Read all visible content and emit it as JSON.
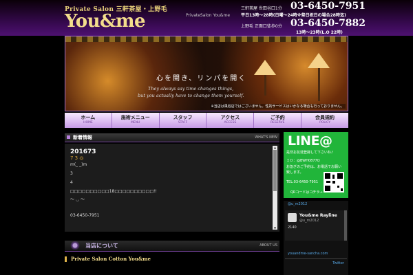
{
  "header": {
    "brand_top": "Private Salon 三軒茶屋・上野毛",
    "logo": "You&me",
    "brand_sub": "PrivateSalon You&me",
    "shop1": {
      "loc": "三軒茶屋 世田谷口1分",
      "phone": "03-6450-7951",
      "hours": "平日13時～28時(日曜～24時※祭日祝日の場合28時迄)"
    },
    "shop2": {
      "loc": "上野毛 正面口徒歩0分",
      "phone": "03-6450-7882",
      "hours": "13時～23時(L.O 22時)"
    }
  },
  "hero": {
    "heading": "心を開き、リンパを開く",
    "en1": "They always say time changes things,",
    "en2": "but you actually have to change them yourself.",
    "note": "※当店は風俗店ではございません。性的サービスはいかなる場合も行っておりません。"
  },
  "nav": [
    {
      "jp": "ホーム",
      "en": "HOME"
    },
    {
      "jp": "施術メニュー",
      "en": "MENU"
    },
    {
      "jp": "スタッフ",
      "en": "STAFF"
    },
    {
      "jp": "アクセス",
      "en": "ACCESS"
    },
    {
      "jp": "ご予約",
      "en": "RESERVE"
    },
    {
      "jp": "会員規約",
      "en": "POLICY"
    }
  ],
  "news": {
    "section_title": "新着情報",
    "more": "WHAT'S NEW",
    "title": "201673",
    "date": "7 3 ◎",
    "lines": [
      "m(_ _)m",
      "3",
      "4",
      "□□□□□□□□□□18□□□□□□□□□□!!",
      "～ ◡ ～",
      "03-6450-7951"
    ]
  },
  "about": {
    "section_title": "当店について",
    "more": "ABOUT US",
    "subtitle": "Private Salon Cotton  You&me"
  },
  "line": {
    "logo": "LINE@",
    "lines": [
      "是非お友達登録して下さいね♪",
      "ＩＤ：@BWH0877Q",
      "お急ぎのご予約は、お電話でお願い",
      "致します。",
      "TEL:03-6450-7951",
      "QRコードはコチラ→"
    ]
  },
  "twitter": {
    "handle": "@u_m2012",
    "name": "You&me Rayline",
    "uid": "@u_m2012",
    "body": "2140",
    "link": "youandme-sancha.com",
    "footer": "Twitter"
  }
}
